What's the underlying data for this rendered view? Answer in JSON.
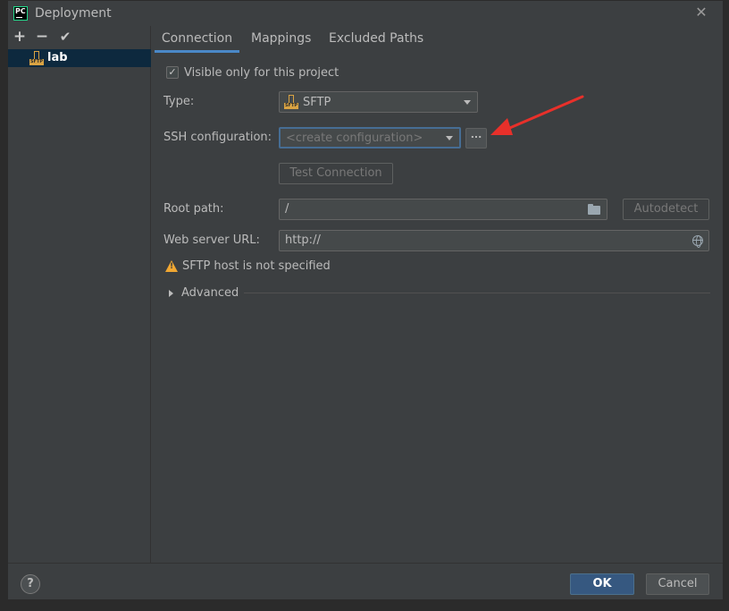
{
  "window": {
    "title": "Deployment",
    "close_icon": "close-icon",
    "app_icon": "pycharm-icon"
  },
  "left_panel": {
    "toolbar": {
      "add": "+",
      "remove": "−",
      "apply": "✔"
    },
    "servers": [
      {
        "label": "lab",
        "icon": "sftp-server-icon",
        "selected": true
      }
    ]
  },
  "tabs": [
    {
      "label": "Connection",
      "active": true
    },
    {
      "label": "Mappings",
      "active": false
    },
    {
      "label": "Excluded Paths",
      "active": false
    }
  ],
  "connection": {
    "visible_only_label": "Visible only for this project",
    "visible_only_checked": true,
    "type_label": "Type:",
    "type_value": "SFTP",
    "ssh_label": "SSH configuration:",
    "ssh_placeholder": "<create configuration>",
    "browse_label": "...",
    "test_button": "Test Connection",
    "root_label": "Root path:",
    "root_value": "/",
    "autodetect_button": "Autodetect",
    "web_label": "Web server URL:",
    "web_value": "http://",
    "warning_text": "SFTP host is not specified",
    "advanced_label": "Advanced"
  },
  "footer": {
    "help": "?",
    "ok": "OK",
    "cancel": "Cancel"
  },
  "colors": {
    "accent": "#4a88c7",
    "ok_button": "#365880",
    "warning": "#f0a732",
    "annotation_arrow": "#e8302a",
    "selection": "#0d293e"
  }
}
